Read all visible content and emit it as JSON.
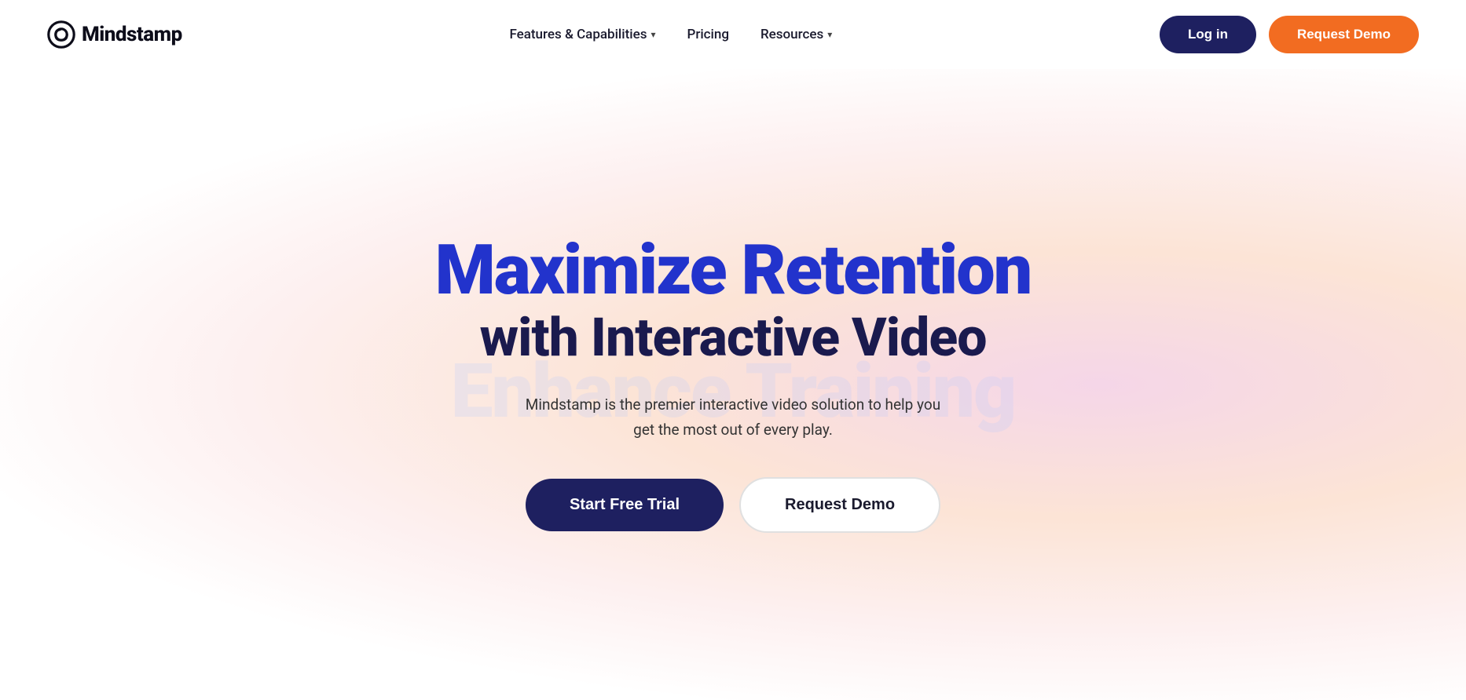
{
  "nav": {
    "logo_text": "Mindstamp",
    "links": [
      {
        "label": "Features & Capabilities",
        "has_dropdown": true
      },
      {
        "label": "Pricing",
        "has_dropdown": false
      },
      {
        "label": "Resources",
        "has_dropdown": true
      }
    ],
    "login_label": "Log in",
    "request_demo_label": "Request Demo"
  },
  "hero": {
    "title_line1": "Maximize Retention",
    "title_line2": "with Interactive Video",
    "ghost_text": "Enhance Training",
    "description": "Mindstamp is the premier interactive video solution to help you get the most out of every play.",
    "cta_primary": "Start Free Trial",
    "cta_secondary": "Request Demo"
  }
}
